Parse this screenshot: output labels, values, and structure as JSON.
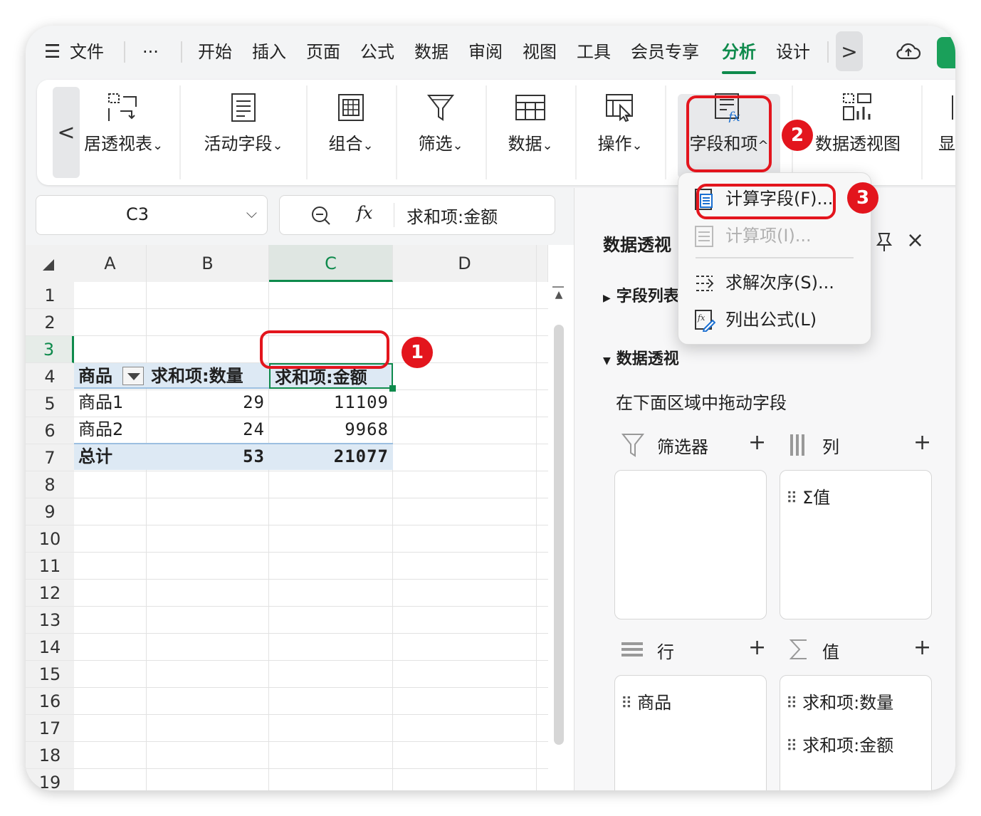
{
  "menubar": {
    "items": [
      "文件",
      "···",
      "开始",
      "插入",
      "页面",
      "公式",
      "数据",
      "审阅",
      "视图",
      "工具",
      "会员专享",
      "分析",
      "设计"
    ],
    "active": "分析",
    "next": ">"
  },
  "ribbon": {
    "prev": "<",
    "items": [
      {
        "label": "居透视表",
        "icon": "pivot-table-icon"
      },
      {
        "label": "活动字段",
        "icon": "active-field-icon"
      },
      {
        "label": "组合",
        "icon": "group-icon"
      },
      {
        "label": "筛选",
        "icon": "filter-icon"
      },
      {
        "label": "数据",
        "icon": "data-icon"
      },
      {
        "label": "操作",
        "icon": "action-icon"
      },
      {
        "label": "字段和项",
        "icon": "fields-items-icon"
      },
      {
        "label": "数据透视图",
        "icon": "pivot-chart-icon"
      },
      {
        "label": "显",
        "icon": "show-icon"
      }
    ],
    "caret": "⌄"
  },
  "formula_bar": {
    "cell_ref": "C3",
    "fx": "fx",
    "content": "求和项:金额"
  },
  "grid": {
    "columns": [
      "A",
      "B",
      "C",
      "D"
    ],
    "rows": [
      "1",
      "2",
      "3",
      "4",
      "5",
      "6",
      "7",
      "8",
      "9",
      "10",
      "11",
      "12",
      "13",
      "14",
      "15",
      "16",
      "17",
      "18",
      "19"
    ],
    "header": {
      "a": "商品",
      "b": "求和项:数量",
      "c": "求和项:金额"
    },
    "data": [
      {
        "a": "商品1",
        "b": "29",
        "c": "11109"
      },
      {
        "a": "商品2",
        "b": "24",
        "c": "9968"
      }
    ],
    "total": {
      "a": "总计",
      "b": "53",
      "c": "21077"
    }
  },
  "panel": {
    "title": "数据透视",
    "section_field_list": "字段列表",
    "section_areas": "数据透视",
    "hint": "在下面区域中拖动字段",
    "filters_label": "筛选器",
    "columns_label": "列",
    "rows_label": "行",
    "values_label": "值",
    "add": "+",
    "close": "×",
    "columns_items": [
      "Σ值"
    ],
    "rows_items": [
      "商品"
    ],
    "values_items": [
      "求和项:数量",
      "求和项:金额"
    ]
  },
  "dropdown": {
    "items": [
      "计算字段(F)...",
      "计算项(I)...",
      "求解次序(S)...",
      "列出公式(L)"
    ]
  },
  "badges": [
    "1",
    "2",
    "3"
  ],
  "colors": {
    "accent": "#0e8a4c",
    "annotation": "#e3151d",
    "pivot_fill": "#dde9f4"
  }
}
